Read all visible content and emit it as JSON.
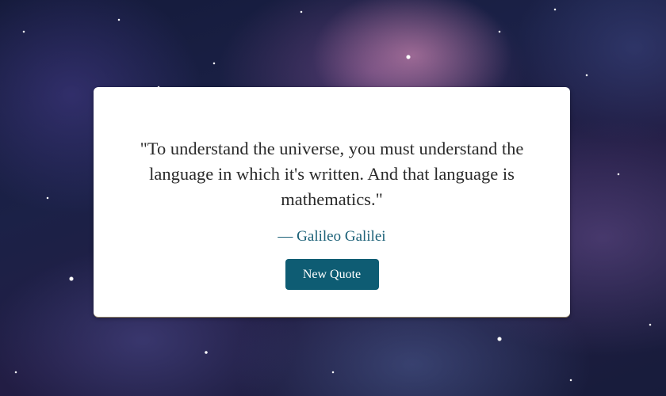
{
  "quote": {
    "text": "\"To understand the universe, you must understand the language in which it's written. And that language is mathematics.\"",
    "author": "— Galileo Galilei"
  },
  "actions": {
    "new_quote_label": "New Quote"
  },
  "colors": {
    "accent": "#0e5c73",
    "author_text": "#1c6178",
    "card_background": "#ffffff",
    "background_base": "#1b2147"
  }
}
